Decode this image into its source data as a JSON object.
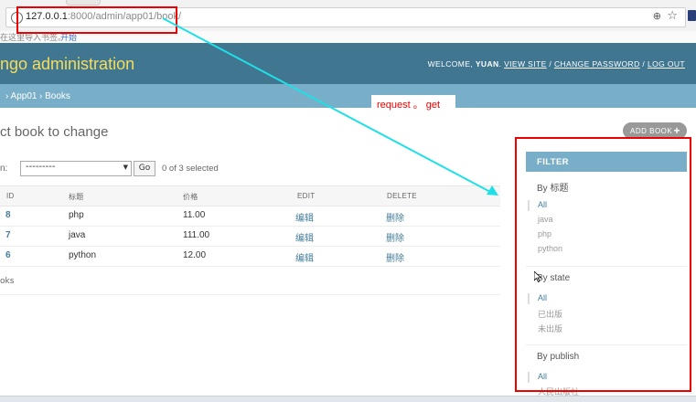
{
  "browser": {
    "url_host": "127.0.0.1",
    "url_rest": ":8000/admin/app01/book/",
    "bookmarks_hint": "在这里导入书签。",
    "bookmarks_link": "开始"
  },
  "header": {
    "site_title": "ngo administration",
    "welcome": "WELCOME,",
    "username": "YUAN",
    "view_site": "VIEW SITE",
    "change_password": "CHANGE PASSWORD",
    "log_out": "LOG OUT",
    "sep": "/"
  },
  "breadcrumbs": {
    "app": "› App01",
    "model": "› Books"
  },
  "annotation": {
    "text": "request 。 get"
  },
  "content": {
    "title": "ct book to change",
    "add_button": "ADD BOOK",
    "actions_label": "n:",
    "action_value": "---------",
    "go": "Go",
    "selected": "0 of 3 selected",
    "columns": [
      "ID",
      "标题",
      "价格",
      "EDIT",
      "DELETE"
    ],
    "rows": [
      {
        "id": "8",
        "title": "php",
        "price": "11.00",
        "edit": "编辑",
        "delete": "删除"
      },
      {
        "id": "7",
        "title": "java",
        "price": "111.00",
        "edit": "编辑",
        "delete": "删除"
      },
      {
        "id": "6",
        "title": "python",
        "price": "12.00",
        "edit": "编辑",
        "delete": "删除"
      }
    ],
    "paginator": "oks"
  },
  "filter": {
    "heading": "FILTER",
    "groups": [
      {
        "title": "By 标题",
        "items": [
          "All",
          "java",
          "php",
          "python"
        ]
      },
      {
        "title": "By state",
        "items": [
          "All",
          "已出版",
          "未出版"
        ]
      },
      {
        "title": "By publish",
        "items": [
          "All",
          "人民出版社"
        ]
      }
    ]
  },
  "colors": {
    "header_bg": "#417690",
    "breadcrumb_bg": "#79aec8",
    "site_title": "#f5dd5d",
    "link": "#447e9b",
    "annotation": "#e00000",
    "arrow": "#1fe0e6"
  },
  "icons": [
    "info-icon",
    "zoom-icon",
    "star-icon",
    "plus-icon",
    "cursor-icon",
    "dropdown-arrow-icon"
  ]
}
